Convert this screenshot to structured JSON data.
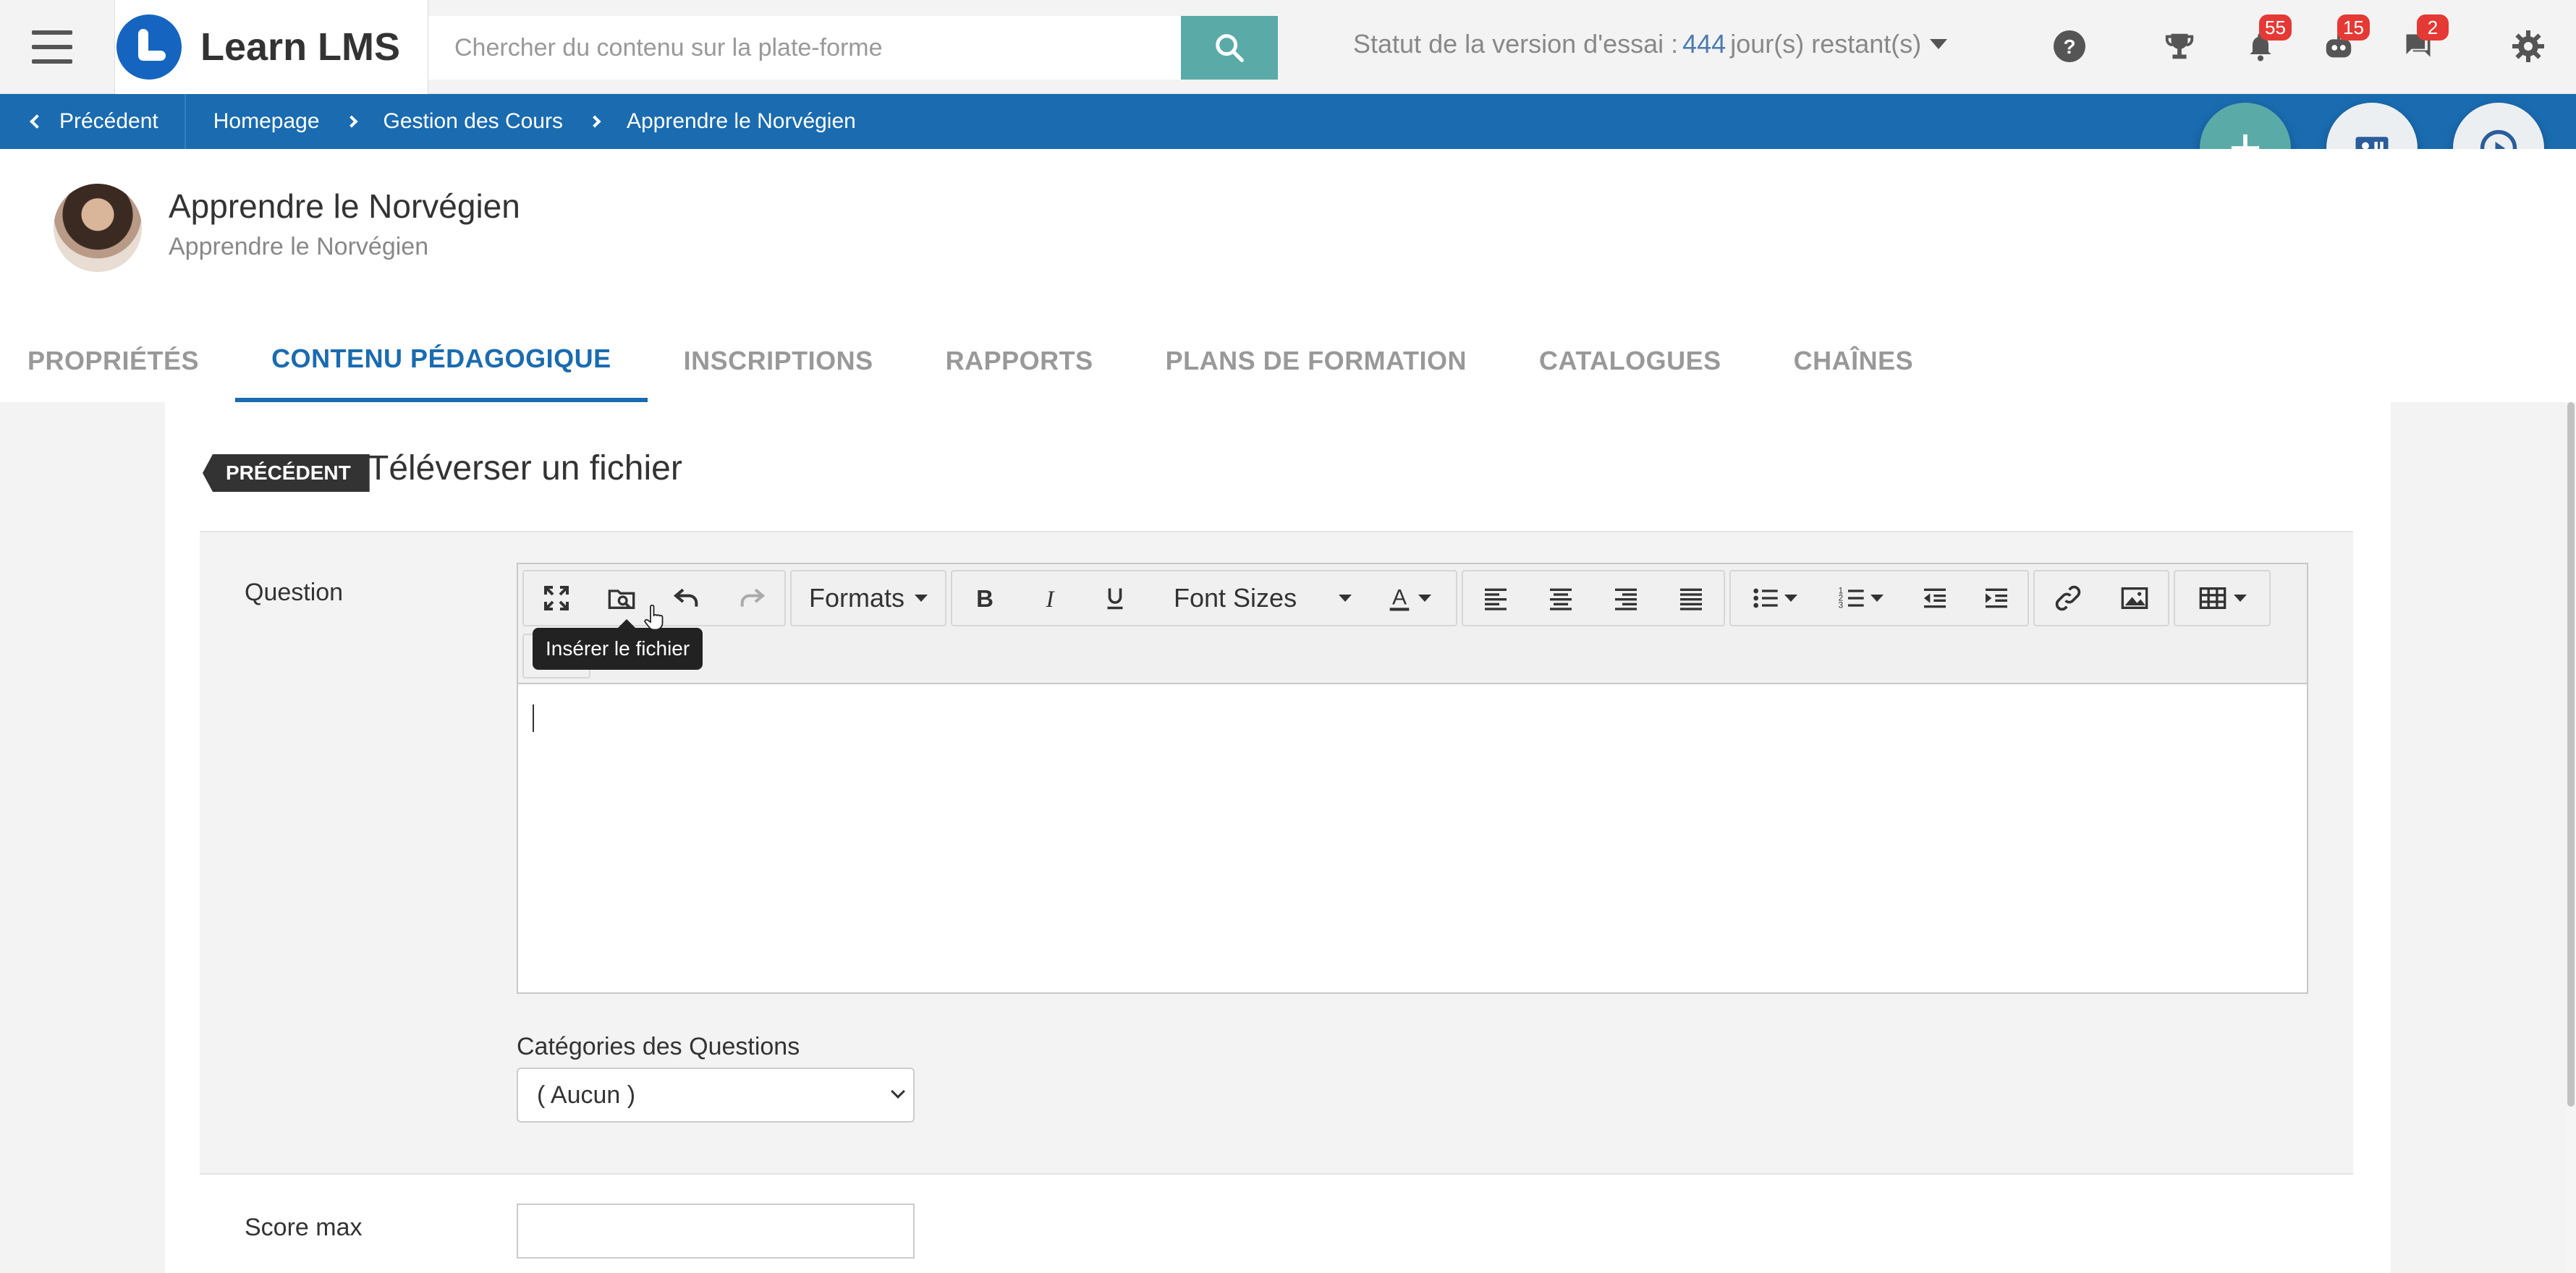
{
  "app": {
    "name": "Learn LMS",
    "search_placeholder": "Chercher du contenu sur la plate-forme",
    "trial_prefix": "Statut de la version d'essai :",
    "trial_days": "444",
    "trial_suffix": "jour(s) restant(s)",
    "badges": {
      "notifications": "55",
      "robot": "15",
      "messages": "2"
    }
  },
  "breadcrumb": {
    "back_label": "Précédent",
    "items": [
      "Homepage",
      "Gestion des Cours",
      "Apprendre le Norvégien"
    ]
  },
  "course": {
    "title": "Apprendre le Norvégien",
    "subtitle": "Apprendre le Norvégien"
  },
  "tabs": [
    {
      "label": "PROPRIÉTÉS",
      "active": false
    },
    {
      "label": "CONTENU PÉDAGOGIQUE",
      "active": true
    },
    {
      "label": "INSCRIPTIONS",
      "active": false
    },
    {
      "label": "RAPPORTS",
      "active": false
    },
    {
      "label": "PLANS DE FORMATION",
      "active": false
    },
    {
      "label": "CATALOGUES",
      "active": false
    },
    {
      "label": "CHAÎNES",
      "active": false
    }
  ],
  "section": {
    "prev_tag": "PRÉCÉDENT",
    "title": "Téléverser un fichier"
  },
  "form": {
    "question_label": "Question",
    "toolbar": {
      "formats": "Formats",
      "font_sizes": "Font Sizes",
      "tooltip": "Insérer le fichier"
    },
    "category_label": "Catégories des Questions",
    "category_value": "( Aucun )",
    "score_label": "Score max",
    "score_value": ""
  },
  "colors": {
    "brand_blue": "#1a6bb0",
    "teal": "#5aaaa8",
    "badge_red": "#e53935"
  }
}
